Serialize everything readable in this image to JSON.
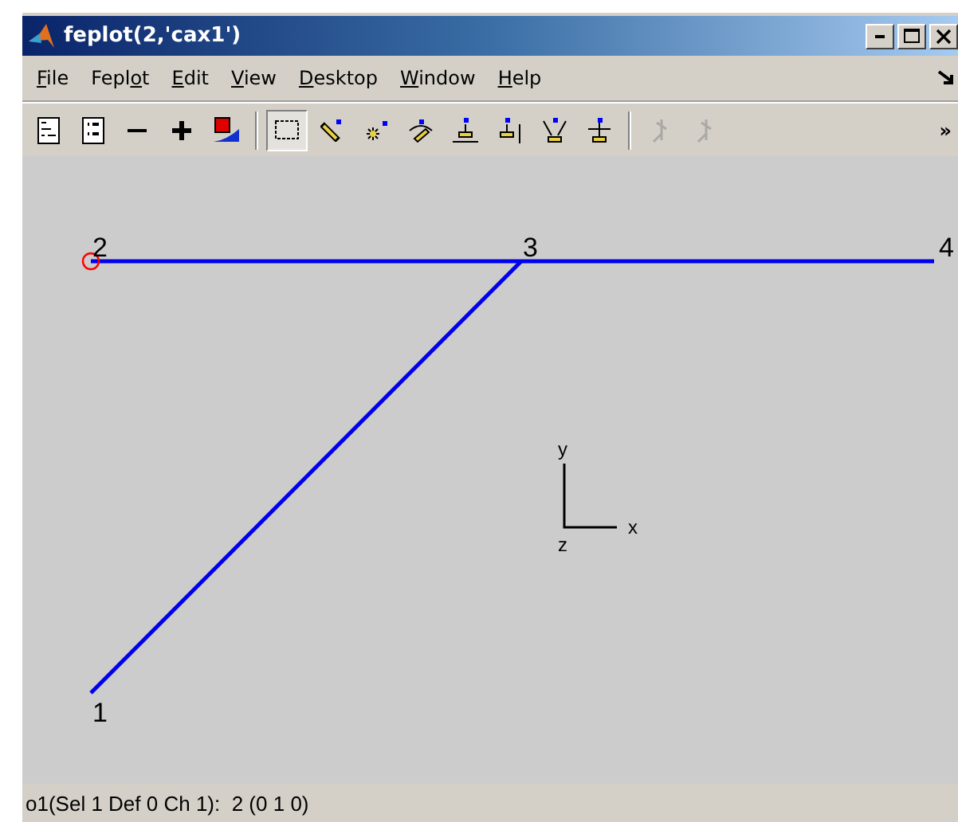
{
  "window": {
    "title": "feplot(2,'cax1')"
  },
  "menu": [
    {
      "label": "File"
    },
    {
      "label": "Feplot"
    },
    {
      "label": "Edit"
    },
    {
      "label": "View"
    },
    {
      "label": "Desktop"
    },
    {
      "label": "Window"
    },
    {
      "label": "Help"
    }
  ],
  "toolbar": [
    {
      "kind": "mfile",
      "selected": false,
      "disabled": false
    },
    {
      "kind": "list",
      "selected": false,
      "disabled": false
    },
    {
      "kind": "minus",
      "selected": false,
      "disabled": false
    },
    {
      "kind": "plus",
      "selected": false,
      "disabled": false
    },
    {
      "kind": "colorbar",
      "selected": false,
      "disabled": false
    },
    {
      "kind": "select",
      "selected": true,
      "disabled": false
    },
    {
      "kind": "pointer",
      "selected": false,
      "disabled": false
    },
    {
      "kind": "star",
      "selected": false,
      "disabled": false
    },
    {
      "kind": "rotate",
      "selected": false,
      "disabled": false
    },
    {
      "kind": "panx",
      "selected": false,
      "disabled": false
    },
    {
      "kind": "panz",
      "selected": false,
      "disabled": false
    },
    {
      "kind": "zoom",
      "selected": false,
      "disabled": false
    },
    {
      "kind": "spin",
      "selected": false,
      "disabled": false
    },
    {
      "kind": "axis",
      "selected": false,
      "disabled": true
    },
    {
      "kind": "axis",
      "selected": false,
      "disabled": true
    }
  ],
  "toolbar_more": "»",
  "plot": {
    "nodes": [
      {
        "label": "2",
        "selected": true
      },
      {
        "label": "3",
        "selected": false
      },
      {
        "label": "4",
        "selected": false
      },
      {
        "label": "1",
        "selected": false
      }
    ],
    "triad": {
      "x": "x",
      "y": "y",
      "z": "z"
    }
  },
  "status_bar": "o1(Sel 1 Def 0 Ch 1):  2 (0 1 0)"
}
